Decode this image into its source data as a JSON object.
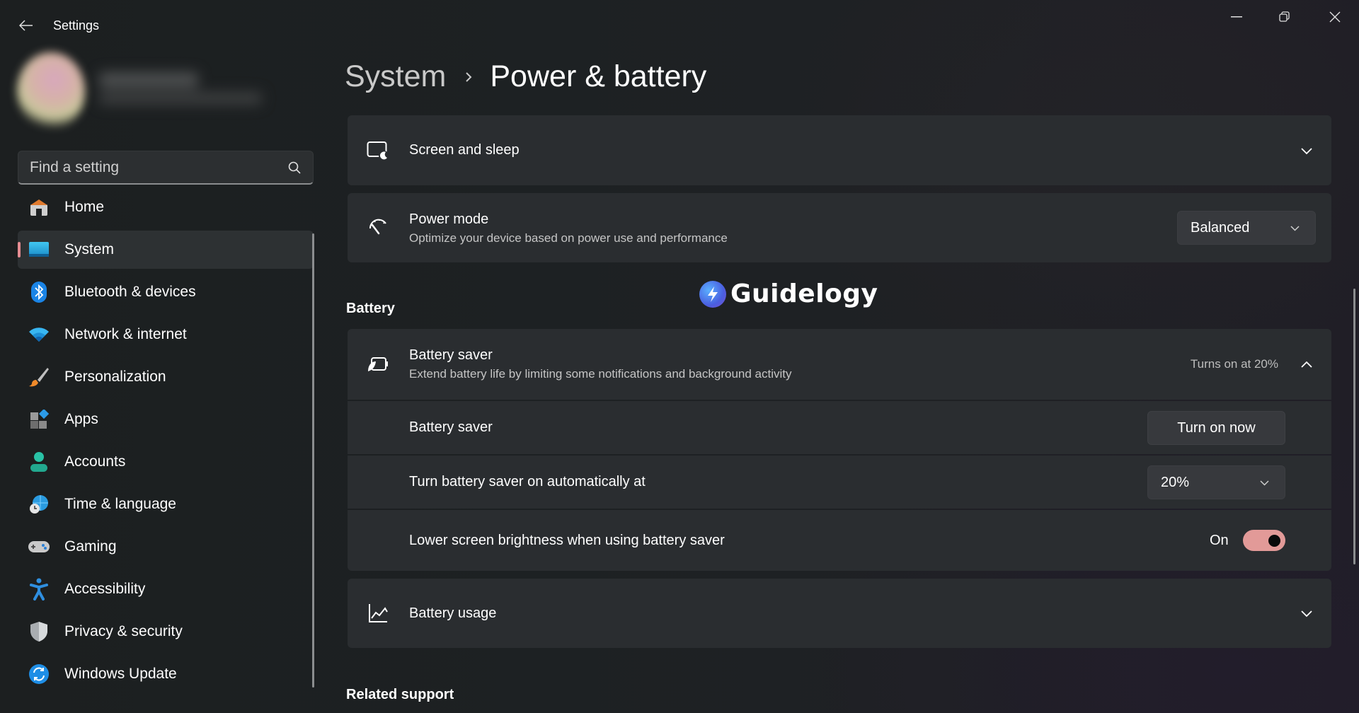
{
  "window": {
    "title": "Settings",
    "controls": {
      "minimize": "minimize",
      "maximize": "restore",
      "close": "close"
    }
  },
  "search": {
    "placeholder": "Find a setting",
    "value": ""
  },
  "sidebar": {
    "items": [
      {
        "label": "Home",
        "icon": "home-icon",
        "selected": false
      },
      {
        "label": "System",
        "icon": "system-display-icon",
        "selected": true
      },
      {
        "label": "Bluetooth & devices",
        "icon": "bluetooth-icon",
        "selected": false
      },
      {
        "label": "Network & internet",
        "icon": "wifi-icon",
        "selected": false
      },
      {
        "label": "Personalization",
        "icon": "paintbrush-icon",
        "selected": false
      },
      {
        "label": "Apps",
        "icon": "apps-icon",
        "selected": false
      },
      {
        "label": "Accounts",
        "icon": "person-icon",
        "selected": false
      },
      {
        "label": "Time & language",
        "icon": "globe-clock-icon",
        "selected": false
      },
      {
        "label": "Gaming",
        "icon": "gamepad-icon",
        "selected": false
      },
      {
        "label": "Accessibility",
        "icon": "accessibility-icon",
        "selected": false
      },
      {
        "label": "Privacy & security",
        "icon": "shield-icon",
        "selected": false
      },
      {
        "label": "Windows Update",
        "icon": "update-icon",
        "selected": false
      }
    ]
  },
  "breadcrumb": {
    "parent": "System",
    "separator": "›",
    "current": "Power & battery"
  },
  "main": {
    "screen_sleep": {
      "title": "Screen and sleep"
    },
    "power_mode": {
      "title": "Power mode",
      "subtitle": "Optimize your device based on power use and performance",
      "selected": "Balanced"
    },
    "battery_section": "Battery",
    "battery_saver": {
      "title": "Battery saver",
      "subtitle": "Extend battery life by limiting some notifications and background activity",
      "status": "Turns on at 20%",
      "rows": {
        "saver_label": "Battery saver",
        "saver_button": "Turn on now",
        "auto_label": "Turn battery saver on automatically at",
        "auto_value": "20%",
        "brightness_label": "Lower screen brightness when using battery saver",
        "brightness_state": "On",
        "brightness_on": true
      }
    },
    "battery_usage": {
      "title": "Battery usage"
    },
    "related_support": "Related support"
  },
  "watermark": {
    "text": "Guidelogy"
  },
  "colors": {
    "accent": "#e58c92",
    "toggle_on": "#e29a98",
    "card_bg": "#2a2d30",
    "window_bg": "#1c1f21"
  }
}
